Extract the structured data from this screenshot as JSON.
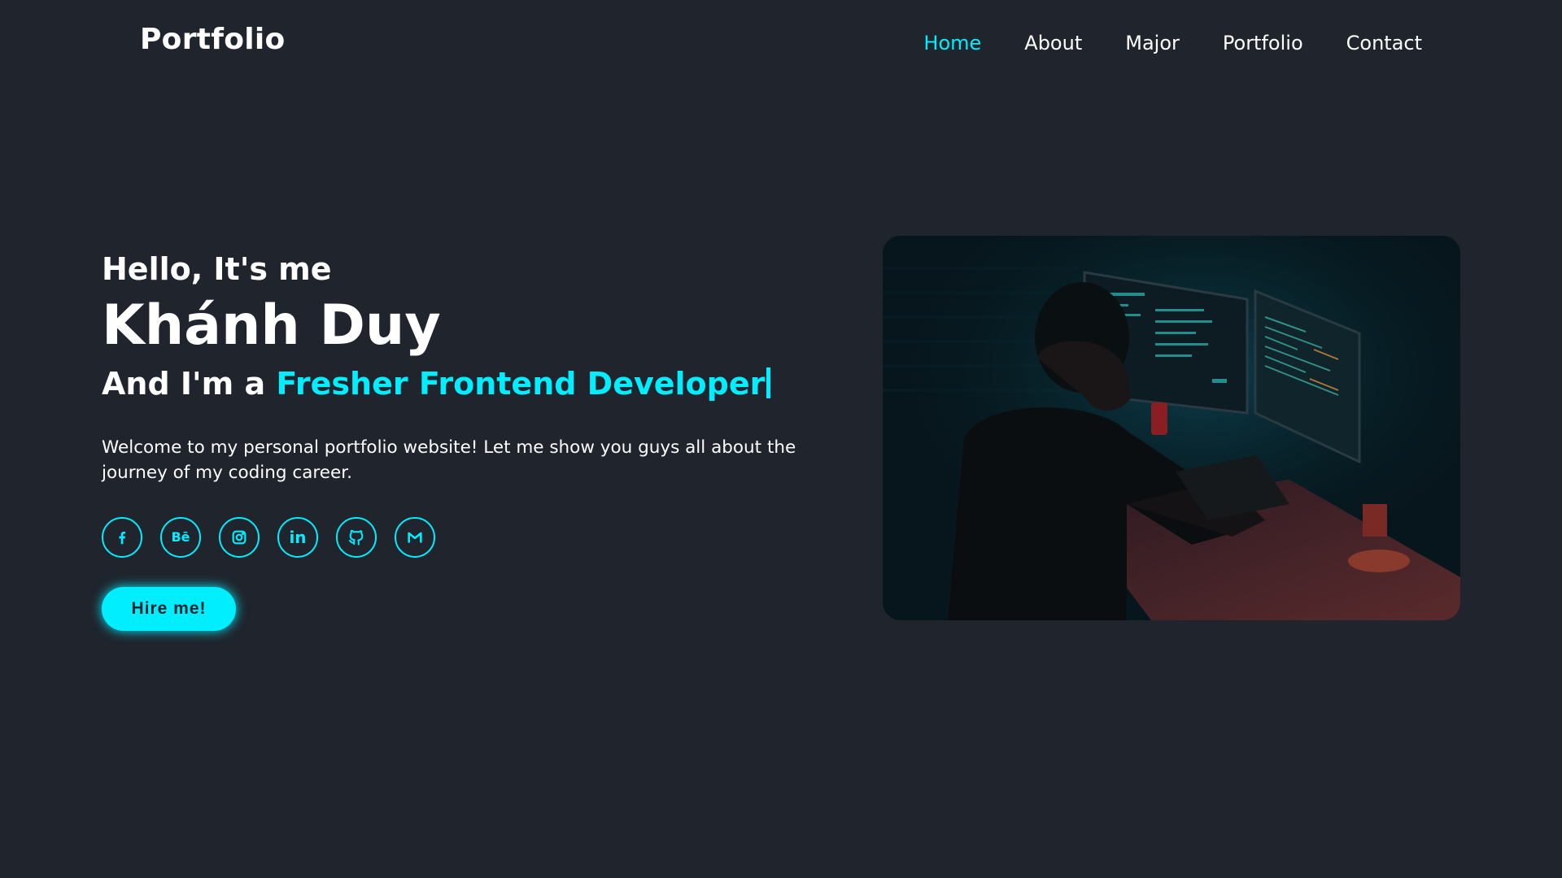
{
  "header": {
    "logo": "Portfolio",
    "nav": [
      "Home",
      "About",
      "Major",
      "Portfolio",
      "Contact"
    ],
    "active": "Home"
  },
  "hero": {
    "greeting": "Hello, It's me",
    "name": "Khánh Duy",
    "role_prefix": "And I'm a ",
    "role_highlight": "Fresher Frontend Developer",
    "intro": "Welcome to my personal portfolio website! Let me show you guys all about the journey of my coding career.",
    "socials": [
      "facebook-icon",
      "behance-icon",
      "instagram-icon",
      "linkedin-icon",
      "github-icon",
      "gmail-icon"
    ],
    "socials_behance_label": "Bē",
    "socials_linkedin_label": "in",
    "hire_button": "Hire me!"
  },
  "colors": {
    "background": "#1f242d",
    "accent": "#00eeff",
    "text": "#ffffff"
  }
}
